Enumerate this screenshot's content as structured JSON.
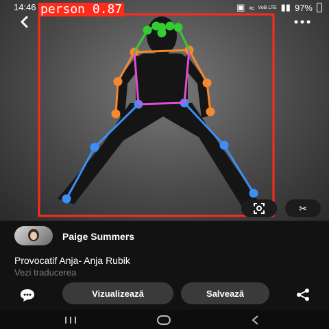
{
  "status_bar": {
    "time": "14:46",
    "battery": "97%",
    "signal_text": "VoB LTE"
  },
  "detection": {
    "label": "person 0.87",
    "box_color": "#ff2b1a"
  },
  "photo_actions": {
    "lens_icon": "visual-search-icon",
    "scissors_icon": "scissors-icon"
  },
  "pin": {
    "author": "Paige Summers",
    "title": "Provocatif Anja- Anja Rubik",
    "translate_link": "Vezi traducerea"
  },
  "actions": {
    "view_label": "Vizualizează",
    "save_label": "Salvează"
  },
  "colors": {
    "face": "#33cc33",
    "arms": "#f5892d",
    "torso": "#e14ed3",
    "legs": "#3d8ff5"
  }
}
